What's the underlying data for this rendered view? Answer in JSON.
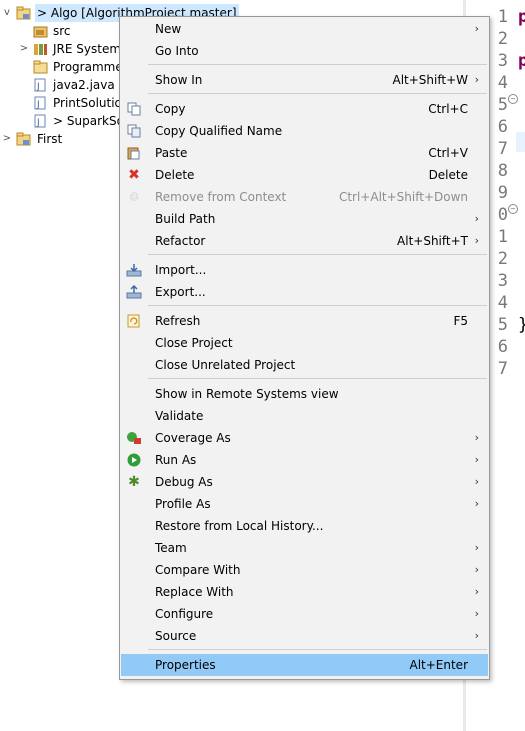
{
  "tree": {
    "items": [
      {
        "label": "> Algo [AlgorithmProject master]",
        "icon": "project-folder-icon",
        "twisty": "v"
      },
      {
        "label": "src",
        "icon": "package-folder-icon",
        "twisty": ""
      },
      {
        "label": "JRE System L",
        "icon": "library-icon",
        "twisty": ">"
      },
      {
        "label": "Programmer",
        "icon": "folder-icon",
        "twisty": ""
      },
      {
        "label": "java2.java",
        "icon": "java-file-icon",
        "twisty": ""
      },
      {
        "label": "PrintSolution",
        "icon": "java-file-icon",
        "twisty": ""
      },
      {
        "label": "> SuparkSol",
        "icon": "java-file-icon",
        "twisty": ""
      },
      {
        "label": "First",
        "icon": "project-folder-icon",
        "twisty": ">"
      }
    ]
  },
  "editor": {
    "line_numbers": [
      "1",
      "2",
      "3",
      "4",
      "5",
      "6",
      "7",
      "8",
      "9",
      "0",
      "1",
      "2",
      "3",
      "4",
      "5",
      "6",
      "7"
    ],
    "code_chars": [
      "p",
      "p",
      "}"
    ]
  },
  "menu": {
    "items": [
      {
        "label": "New",
        "shortcut": "",
        "submenu": true,
        "icon": "",
        "disabled": false
      },
      {
        "label": "Go Into",
        "shortcut": "",
        "submenu": false,
        "icon": "",
        "disabled": false
      },
      {
        "label": "Show In",
        "shortcut": "Alt+Shift+W",
        "submenu": true,
        "icon": "",
        "disabled": false
      },
      {
        "label": "Copy",
        "shortcut": "Ctrl+C",
        "submenu": false,
        "icon": "copy-icon",
        "disabled": false
      },
      {
        "label": "Copy Qualified Name",
        "shortcut": "",
        "submenu": false,
        "icon": "copy-qualified-name-icon",
        "disabled": false
      },
      {
        "label": "Paste",
        "shortcut": "Ctrl+V",
        "submenu": false,
        "icon": "paste-icon",
        "disabled": false
      },
      {
        "label": "Delete",
        "shortcut": "Delete",
        "submenu": false,
        "icon": "delete-icon",
        "disabled": false
      },
      {
        "label": "Remove from Context",
        "shortcut": "Ctrl+Alt+Shift+Down",
        "submenu": false,
        "icon": "remove-context-icon",
        "disabled": true
      },
      {
        "label": "Build Path",
        "shortcut": "",
        "submenu": true,
        "icon": "",
        "disabled": false
      },
      {
        "label": "Refactor",
        "shortcut": "Alt+Shift+T",
        "submenu": true,
        "icon": "",
        "disabled": false
      },
      {
        "label": "Import...",
        "shortcut": "",
        "submenu": false,
        "icon": "import-icon",
        "disabled": false
      },
      {
        "label": "Export...",
        "shortcut": "",
        "submenu": false,
        "icon": "export-icon",
        "disabled": false
      },
      {
        "label": "Refresh",
        "shortcut": "F5",
        "submenu": false,
        "icon": "refresh-icon",
        "disabled": false
      },
      {
        "label": "Close Project",
        "shortcut": "",
        "submenu": false,
        "icon": "",
        "disabled": false
      },
      {
        "label": "Close Unrelated Project",
        "shortcut": "",
        "submenu": false,
        "icon": "",
        "disabled": false
      },
      {
        "label": "Show in Remote Systems view",
        "shortcut": "",
        "submenu": false,
        "icon": "",
        "disabled": false
      },
      {
        "label": "Validate",
        "shortcut": "",
        "submenu": false,
        "icon": "",
        "disabled": false
      },
      {
        "label": "Coverage As",
        "shortcut": "",
        "submenu": true,
        "icon": "coverage-icon",
        "disabled": false
      },
      {
        "label": "Run As",
        "shortcut": "",
        "submenu": true,
        "icon": "run-icon",
        "disabled": false
      },
      {
        "label": "Debug As",
        "shortcut": "",
        "submenu": true,
        "icon": "debug-icon",
        "disabled": false
      },
      {
        "label": "Profile As",
        "shortcut": "",
        "submenu": true,
        "icon": "",
        "disabled": false
      },
      {
        "label": "Restore from Local History...",
        "shortcut": "",
        "submenu": false,
        "icon": "",
        "disabled": false
      },
      {
        "label": "Team",
        "shortcut": "",
        "submenu": true,
        "icon": "",
        "disabled": false
      },
      {
        "label": "Compare With",
        "shortcut": "",
        "submenu": true,
        "icon": "",
        "disabled": false
      },
      {
        "label": "Replace With",
        "shortcut": "",
        "submenu": true,
        "icon": "",
        "disabled": false
      },
      {
        "label": "Configure",
        "shortcut": "",
        "submenu": true,
        "icon": "",
        "disabled": false
      },
      {
        "label": "Source",
        "shortcut": "",
        "submenu": true,
        "icon": "",
        "disabled": false
      },
      {
        "label": "Properties",
        "shortcut": "Alt+Enter",
        "submenu": false,
        "icon": "",
        "disabled": false,
        "highlighted": true
      }
    ]
  },
  "colors": {
    "highlight": "#91c9f7",
    "selection": "#cde8ff",
    "keyword": "#7f0055"
  }
}
